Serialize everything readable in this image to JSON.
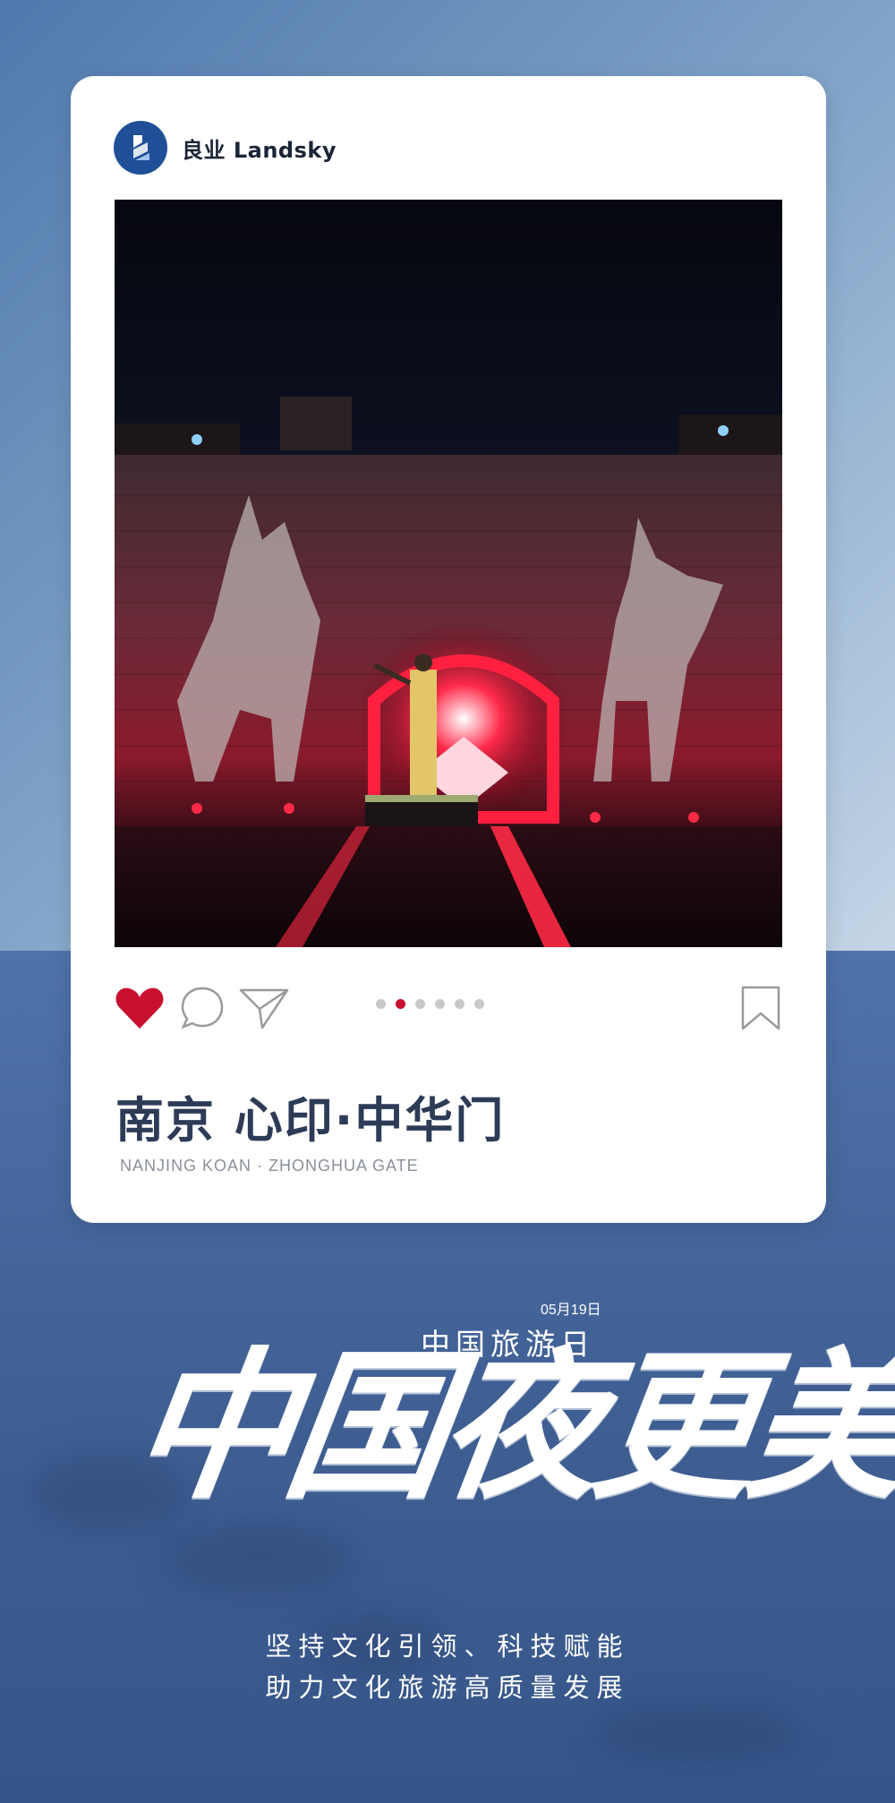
{
  "brand": {
    "name": "良业 Landsky",
    "mark_color": "#1f4f97"
  },
  "post": {
    "photo_icon": "night-gate-photo",
    "carousel": {
      "total": 6,
      "active_index": 2
    },
    "actions": {
      "like_icon": "heart-icon",
      "liked": true,
      "like_color": "#c8102e",
      "comment_icon": "comment-icon",
      "share_icon": "send-icon",
      "bookmark_icon": "bookmark-icon"
    },
    "title_cn": "南京 心印·中华门",
    "title_en": "NANJING  KOAN · ZHONGHUA GATE"
  },
  "event": {
    "date": "05月19日",
    "name": "中国旅游日",
    "headline": "中国夜更美"
  },
  "slogan": {
    "line1": "坚持文化引领、科技赋能",
    "line2": "助力文化旅游高质量发展"
  },
  "colors": {
    "accent": "#c8102e",
    "title": "#2d3b57",
    "bg_bottom": "#3f5f93"
  }
}
